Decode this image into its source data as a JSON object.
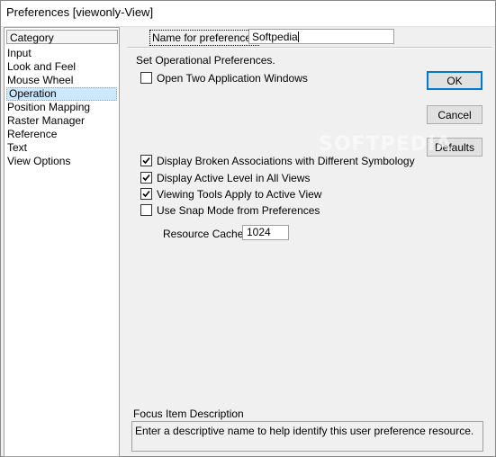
{
  "window": {
    "title": "Preferences [viewonly-View]"
  },
  "sidebar": {
    "header": "Category",
    "items": [
      {
        "label": "Input",
        "selected": false
      },
      {
        "label": "Look and Feel",
        "selected": false
      },
      {
        "label": "Mouse Wheel",
        "selected": false
      },
      {
        "label": "Operation",
        "selected": true
      },
      {
        "label": "Position Mapping",
        "selected": false
      },
      {
        "label": "Raster Manager",
        "selected": false
      },
      {
        "label": "Reference",
        "selected": false
      },
      {
        "label": "Text",
        "selected": false
      },
      {
        "label": "View Options",
        "selected": false
      }
    ]
  },
  "name_field": {
    "label": "Name for preferences",
    "value": "Softpedia"
  },
  "section": {
    "heading": "Set Operational Preferences."
  },
  "options": {
    "open_two": {
      "label": "Open Two Application Windows",
      "checked": false
    },
    "broken_assoc": {
      "label": "Display Broken Associations with Different Symbology",
      "checked": true
    },
    "active_level": {
      "label": "Display Active Level in All Views",
      "checked": true
    },
    "viewing_tools": {
      "label": "Viewing Tools Apply to Active View",
      "checked": true
    },
    "snap_mode": {
      "label": "Use Snap Mode from Preferences",
      "checked": false
    }
  },
  "cache": {
    "label": "Resource Cache:",
    "value": "1024"
  },
  "buttons": {
    "ok": "OK",
    "cancel": "Cancel",
    "defaults": "Defaults"
  },
  "focus": {
    "heading": "Focus Item Description",
    "text": "Enter a descriptive name to help identify this user preference resource."
  },
  "watermark": "SOFTPEDIA",
  "colors": {
    "selection": "#cce8ff",
    "window_bg": "#f0f0f0",
    "default_button_border": "#0078d7"
  }
}
